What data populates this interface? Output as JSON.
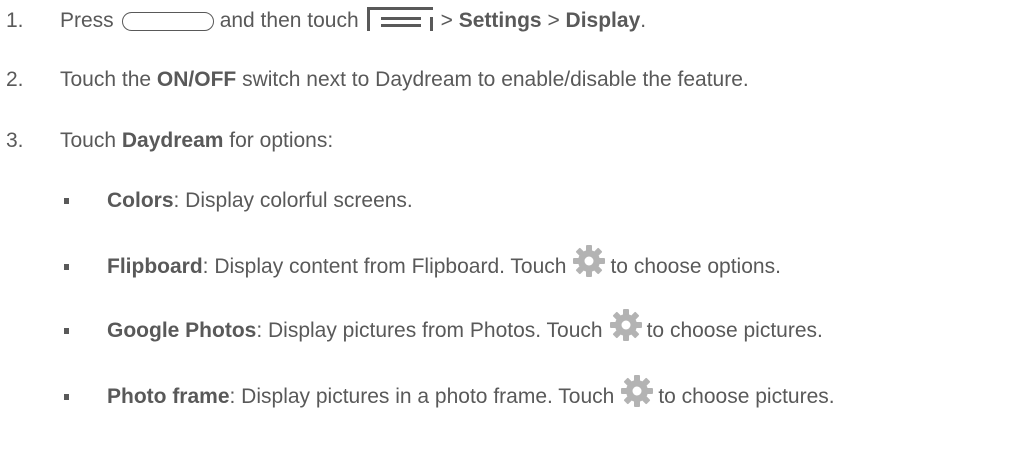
{
  "steps": [
    {
      "number": "1.",
      "parts": {
        "press": "Press",
        "and_then_touch": "and then touch",
        "sep1": ">",
        "settings": "Settings",
        "sep2": ">",
        "display": "Display",
        "end": "."
      },
      "icons": [
        "home-key-icon",
        "menu-key-icon"
      ]
    },
    {
      "number": "2.",
      "parts": {
        "touch": "Touch the",
        "onoff": "ON/OFF",
        "rest": "switch next to Daydream to enable/disable the feature."
      }
    },
    {
      "number": "3.",
      "parts": {
        "touch": "Touch",
        "daydream": "Daydream",
        "rest": "for options:"
      }
    }
  ],
  "options": [
    {
      "name": "Colors",
      "desc": ": Display colorful screens."
    },
    {
      "name": "Flipboard",
      "desc": ": Display content from Flipboard. Touch",
      "after_icon": "to choose options.",
      "icon": "gear-icon"
    },
    {
      "name": "Google Photos",
      "desc": ": Display pictures from Photos. Touch",
      "after_icon": "to choose pictures.",
      "icon": "gear-icon"
    },
    {
      "name": "Photo frame",
      "desc": ": Display pictures in a photo frame. Touch",
      "after_icon": "to choose pictures.",
      "icon": "gear-icon"
    }
  ],
  "colors": {
    "text": "#595959",
    "icon_gray": "#b3b3b3"
  }
}
